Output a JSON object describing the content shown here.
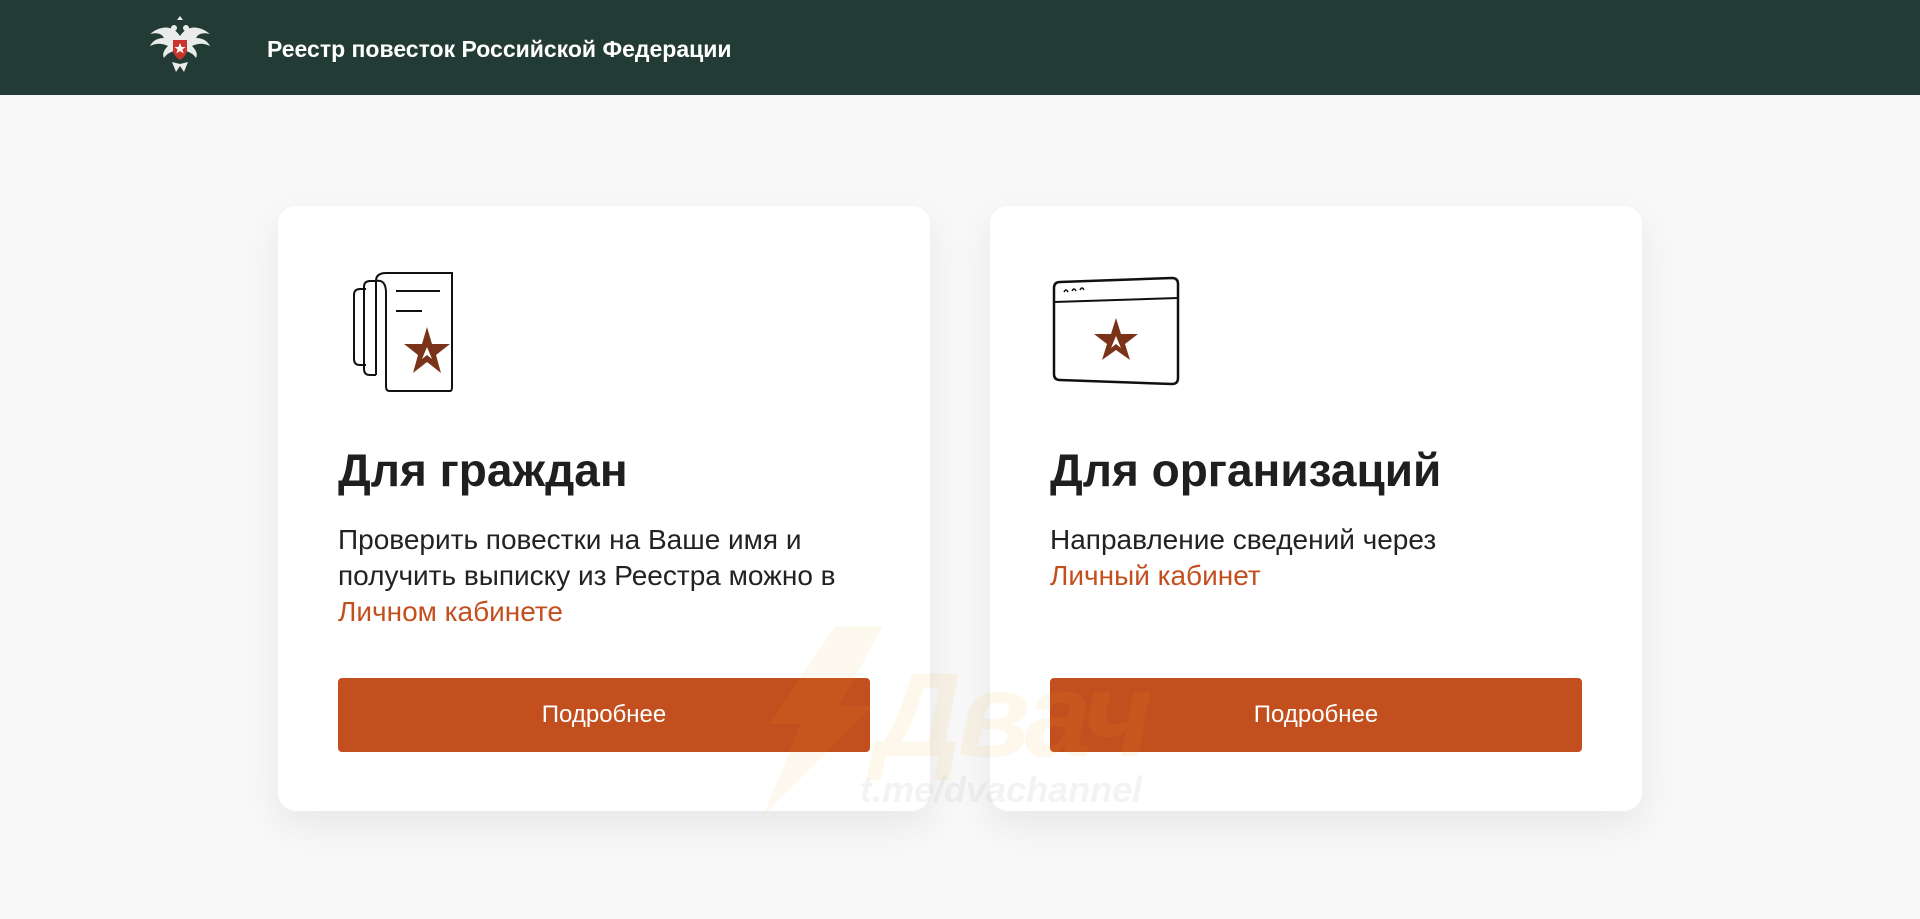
{
  "header": {
    "title": "Реестр повесток Российской Федерации",
    "logo_icon": "double-headed-eagle-emblem-icon"
  },
  "cards": [
    {
      "icon": "documents-with-star-icon",
      "title": "Для граждан",
      "text_before": "Проверить повестки на Ваше имя и получить выписку из Реестра можно в ",
      "link": "Личном кабинете",
      "button": "Подробнее"
    },
    {
      "icon": "browser-window-with-star-icon",
      "title": "Для организаций",
      "text_before": "Направление сведений через ",
      "link": "Личный кабинет",
      "button": "Подробнее"
    }
  ],
  "watermark": {
    "main": "Двач",
    "sub": "t.me/dvachannel"
  },
  "colors": {
    "header_bg": "#233b35",
    "accent": "#c44f1e",
    "page_bg": "#f8f8f8",
    "card_bg": "#ffffff"
  }
}
